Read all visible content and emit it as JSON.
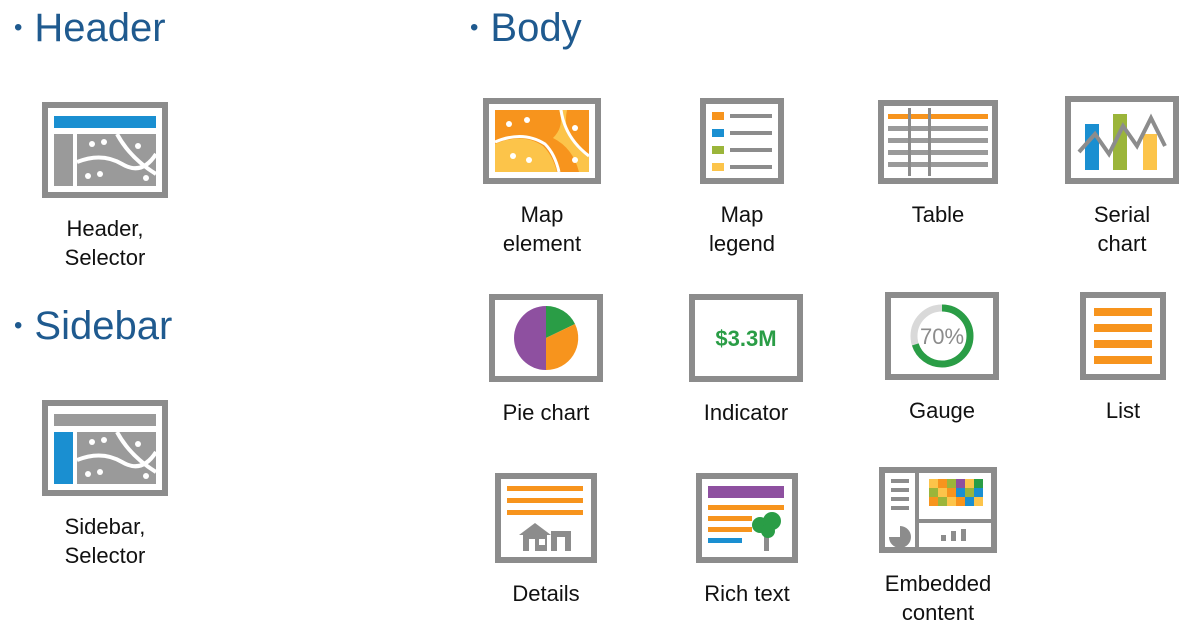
{
  "sections": {
    "header": {
      "title": "Header",
      "items": [
        {
          "label": "Header,\nSelector"
        }
      ]
    },
    "sidebar": {
      "title": "Sidebar",
      "items": [
        {
          "label": "Sidebar,\nSelector"
        }
      ]
    },
    "body": {
      "title": "Body",
      "items": [
        {
          "label": "Map\nelement"
        },
        {
          "label": "Map\nlegend"
        },
        {
          "label": "Table"
        },
        {
          "label": "Serial\nchart"
        },
        {
          "label": "Pie chart"
        },
        {
          "label": "Indicator",
          "value": "$3.3M"
        },
        {
          "label": "Gauge",
          "value": "70%",
          "percent": 70
        },
        {
          "label": "List"
        },
        {
          "label": "Details"
        },
        {
          "label": "Rich text"
        },
        {
          "label": "Embedded\ncontent"
        }
      ]
    }
  },
  "colors": {
    "heading": "#1f5a8f",
    "frame": "#8c8c8c",
    "gray": "#9a9a9a",
    "blue": "#1a8fd1",
    "orange": "#f7941d",
    "yellow": "#fcc44a",
    "green": "#2a9d46",
    "olive": "#9bb53a",
    "purple": "#8e50a0"
  }
}
